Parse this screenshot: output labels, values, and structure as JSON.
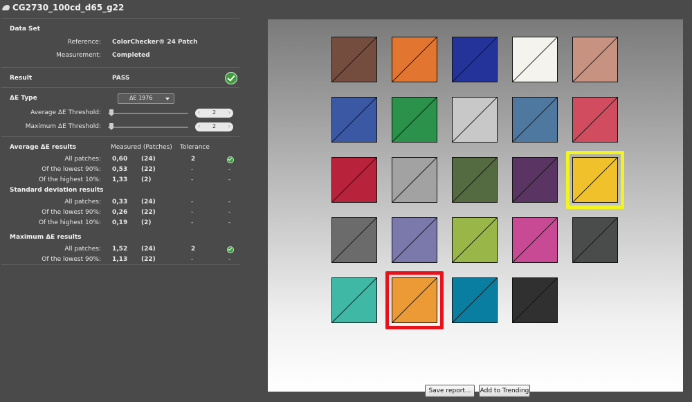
{
  "window": {
    "title": "CG2730_100cd_d65_g22"
  },
  "dataset": {
    "heading": "Data Set",
    "reference_label": "Reference:",
    "reference_value": "ColorChecker® 24 Patch",
    "measurement_label": "Measurement:",
    "measurement_value": "Completed"
  },
  "result": {
    "label": "Result",
    "value": "PASS",
    "icon": "check-circle-icon"
  },
  "de_type": {
    "label": "ΔE Type",
    "selected": "ΔE 1976",
    "avg_threshold_label": "Average  ΔE Threshold:",
    "avg_threshold_value": "2",
    "max_threshold_label": "Maximum ΔE Threshold:",
    "max_threshold_value": "2"
  },
  "avg_results": {
    "heading": "Average ΔE results",
    "col_measured": "Measured (Patches)",
    "col_tolerance": "Tolerance",
    "rows": [
      {
        "label": "All patches:",
        "measured": "0,60",
        "patches": "(24)",
        "tolerance": "2",
        "status": "check"
      },
      {
        "label": "Of the lowest 90%:",
        "measured": "0,53",
        "patches": "(22)",
        "tolerance": "-",
        "status": "-"
      },
      {
        "label": "Of the highest 10%:",
        "measured": "1,33",
        "patches": "(2)",
        "tolerance": "-",
        "status": "-"
      }
    ]
  },
  "std_results": {
    "heading": "Standard deviation results",
    "rows": [
      {
        "label": "All patches:",
        "measured": "0,33",
        "patches": "(24)",
        "tolerance": "-",
        "status": "-"
      },
      {
        "label": "Of the lowest 90%:",
        "measured": "0,26",
        "patches": "(22)",
        "tolerance": "-",
        "status": "-"
      },
      {
        "label": "Of the highest 10%:",
        "measured": "0,19",
        "patches": "(2)",
        "tolerance": "-",
        "status": "-"
      }
    ]
  },
  "max_results": {
    "heading": "Maximum ΔE results",
    "rows": [
      {
        "label": "All patches:",
        "measured": "1,52",
        "patches": "(24)",
        "tolerance": "2",
        "status": "check"
      },
      {
        "label": "Of the lowest 90%:",
        "measured": "1,13",
        "patches": "(22)",
        "tolerance": "-",
        "status": "-"
      }
    ]
  },
  "patches": [
    {
      "color": "#744d3e"
    },
    {
      "color": "#e27630"
    },
    {
      "color": "#23339a"
    },
    {
      "color": "#f5f3ee"
    },
    {
      "color": "#c79380"
    },
    {
      "color": "#3b58a4"
    },
    {
      "color": "#2a924a"
    },
    {
      "color": "#c8c8c8"
    },
    {
      "color": "#4e78a0"
    },
    {
      "color": "#d24c5f"
    },
    {
      "color": "#b8223a"
    },
    {
      "color": "#a2a2a2"
    },
    {
      "color": "#546a40"
    },
    {
      "color": "#5a3563"
    },
    {
      "color": "#f1c12c",
      "highlight": "#f3f41b"
    },
    {
      "color": "#6b6b6b"
    },
    {
      "color": "#7b78ac"
    },
    {
      "color": "#99b749"
    },
    {
      "color": "#c84994"
    },
    {
      "color": "#4a4c4b"
    },
    {
      "color": "#3fb8a6"
    },
    {
      "color": "#eb9a35",
      "highlight": "#e8121b"
    },
    {
      "color": "#0a7ea0"
    },
    {
      "color": "#303030"
    }
  ],
  "buttons": {
    "save_report": "Save report...",
    "add_to_trending": "Add to Trending"
  }
}
